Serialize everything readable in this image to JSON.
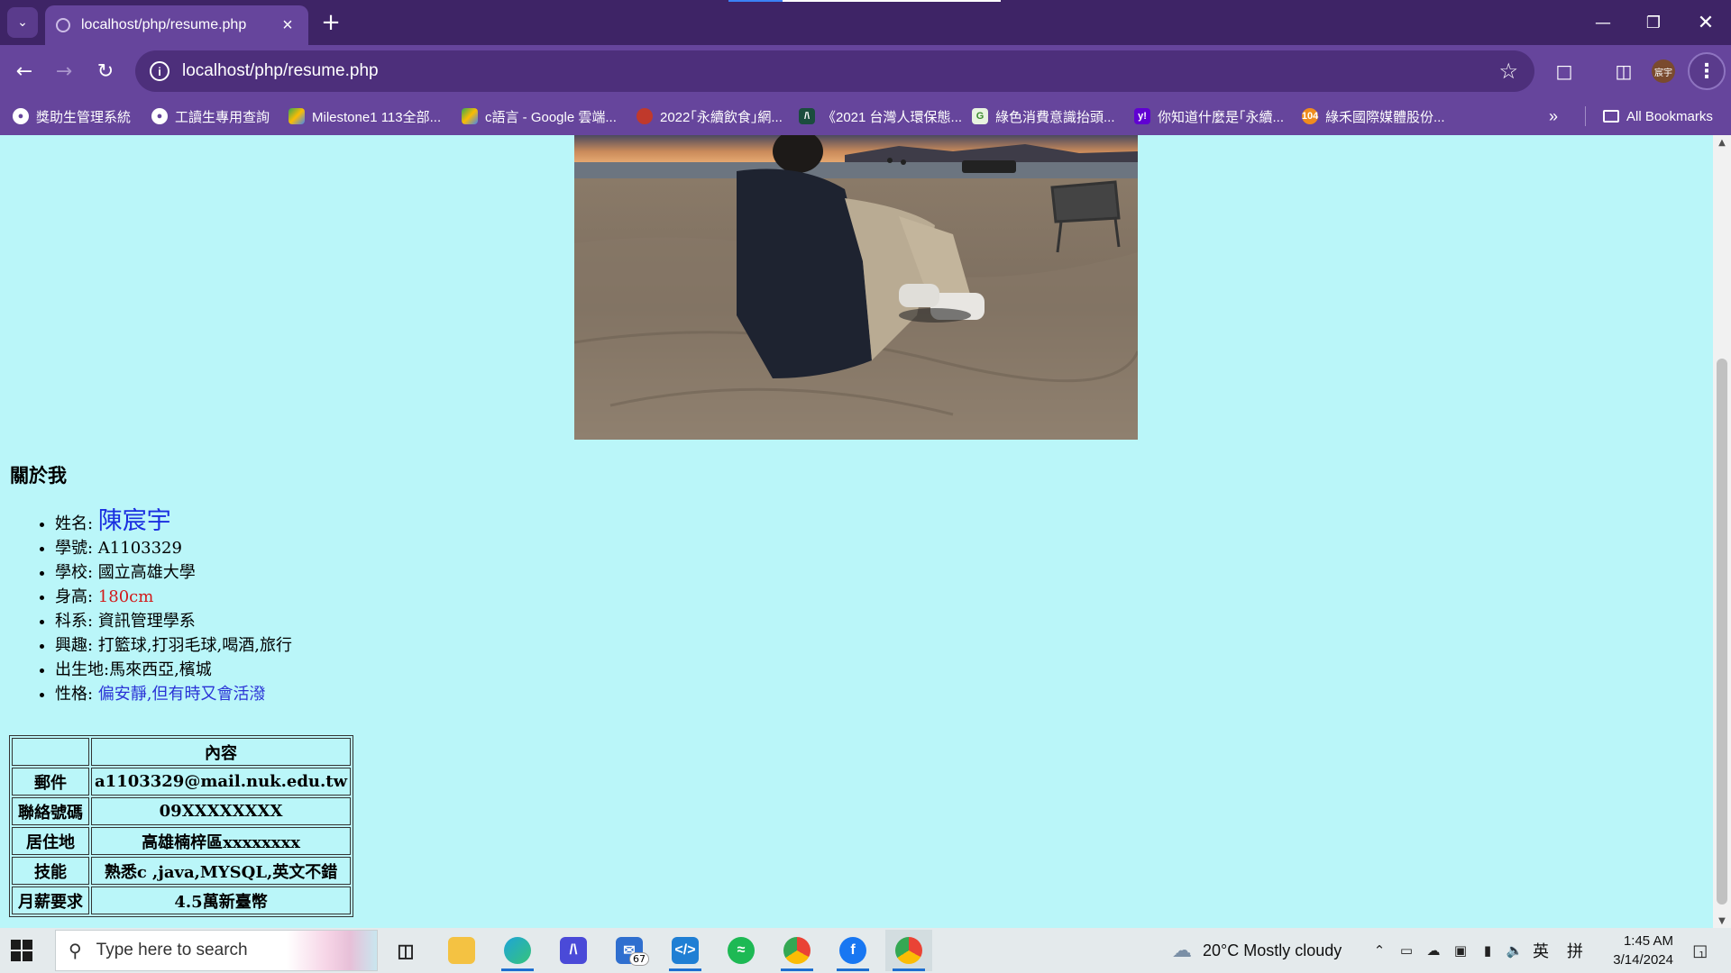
{
  "browser": {
    "tab_title": "localhost/php/resume.php",
    "url": "localhost/php/resume.php",
    "bookmarks": [
      {
        "label": "獎助生管理系統",
        "icon": "globe-icon"
      },
      {
        "label": "工讀生專用查詢",
        "icon": "globe-icon"
      },
      {
        "label": "Milestone1 113全部...",
        "icon": "drive-icon"
      },
      {
        "label": "c語言 - Google 雲端...",
        "icon": "drive-icon"
      },
      {
        "label": "2022｢永續飲食｣網...",
        "icon": "site-icon"
      },
      {
        "label": "《2021 台灣人環保態...",
        "icon": "site-icon"
      },
      {
        "label": "綠色消費意識抬頭...",
        "icon": "site-icon"
      },
      {
        "label": "你知道什麼是｢永續...",
        "icon": "yahoo-icon"
      },
      {
        "label": "綠禾國際媒體股份...",
        "icon": "site-icon"
      }
    ],
    "all_bookmarks": "All Bookmarks",
    "profile_initials": "宸宇"
  },
  "page": {
    "about_heading": "關於我",
    "about": [
      {
        "label": "姓名: ",
        "value": "陳宸宇"
      },
      {
        "label": "學號: ",
        "value": "A1103329"
      },
      {
        "label": "學校: ",
        "value": "國立高雄大學"
      },
      {
        "label": "身高: ",
        "value": "180cm"
      },
      {
        "label": "科系: ",
        "value": "資訊管理學系"
      },
      {
        "label": "興趣: ",
        "value": "打籃球,打羽毛球,喝酒,旅行"
      },
      {
        "label": "出生地:",
        "value": "馬來西亞,檳城"
      },
      {
        "label": "性格: ",
        "value": "偏安靜,但有時又會活潑"
      }
    ],
    "table": {
      "header": [
        "",
        "內容"
      ],
      "rows": [
        [
          "郵件",
          "a1103329@mail.nuk.edu.tw"
        ],
        [
          "聯絡號碼",
          "09XXXXXXXX"
        ],
        [
          "居住地",
          "高雄楠梓區xxxxxxxx"
        ],
        [
          "技能",
          "熟悉c ,java,MYSQL,英文不錯"
        ],
        [
          "月薪要求",
          "4.5萬新臺幣"
        ]
      ]
    }
  },
  "taskbar": {
    "search_placeholder": "Type here to search",
    "mail_badge": "67",
    "weather": "20°C  Mostly cloudy",
    "ime_lang": "英",
    "ime_mode": "拼",
    "time": "1:45 AM",
    "date": "3/14/2024",
    "notification_count": "1"
  }
}
